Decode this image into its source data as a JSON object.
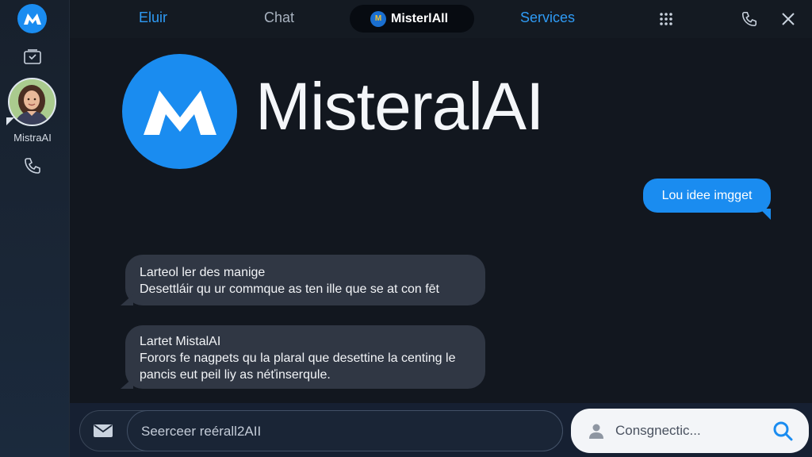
{
  "app": {
    "name": "MisteralAI",
    "accent_color": "#1a8cf0"
  },
  "rail": {
    "logo_icon": "mistral-m-logo",
    "inbox_icon": "inbox-icon",
    "profile_label": "MistraAI",
    "call_icon": "phone-icon"
  },
  "topbar": {
    "tabs": [
      {
        "label": "Eluir",
        "color": "#2f9bf5"
      },
      {
        "label": "Chat",
        "color": "#a9b3c0"
      },
      {
        "label": "MisterlAll",
        "active": true
      },
      {
        "label": "Services",
        "color": "#2f9bf5"
      }
    ],
    "icons": [
      "grid-icon",
      "phone-icon",
      "close-icon"
    ]
  },
  "hero": {
    "title": "MisteralAI"
  },
  "messages": [
    {
      "from": "user",
      "lines": [
        "Lou idee imgget"
      ]
    },
    {
      "from": "bot",
      "lines": [
        "Larteol ler des manige",
        "Desettláir qu ur commque as ten ille que se at con fēt"
      ]
    },
    {
      "from": "bot",
      "lines": [
        "Lartet MistalAI",
        "Forors fe nagpets qu la plaral que desettine la centing le",
        "pancis eut peil liy as néťinserqule."
      ]
    }
  ],
  "composer": {
    "placeholder": "Seercеer reérall2AII"
  },
  "search": {
    "placeholder": "Consgnectic..."
  }
}
